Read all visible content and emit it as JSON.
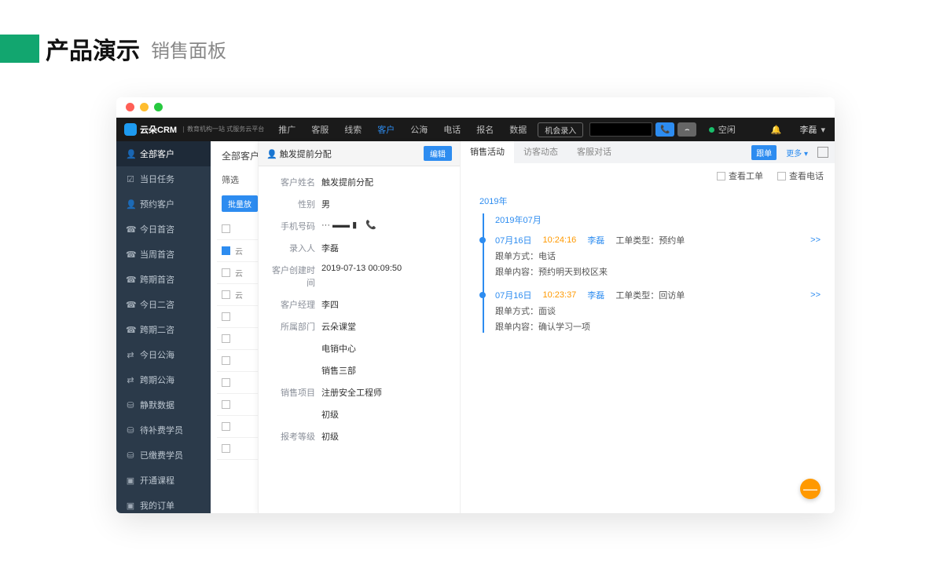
{
  "page": {
    "title_main": "产品演示",
    "title_sub": "销售面板"
  },
  "logo": {
    "brand": "云朵CRM",
    "tagline": "教育机构一站\n式服务云平台"
  },
  "nav": {
    "items": [
      "推广",
      "客服",
      "线索",
      "客户",
      "公海",
      "电话",
      "报名",
      "数据"
    ],
    "active": "客户",
    "opportunity": "机会录入"
  },
  "status": {
    "text": "空闲",
    "user": "李磊",
    "chev": "▾"
  },
  "sidebar": {
    "items": [
      {
        "ico": "👤",
        "label": "全部客户",
        "active": true
      },
      {
        "ico": "☑",
        "label": "当日任务"
      },
      {
        "ico": "👤",
        "label": "预约客户"
      },
      {
        "ico": "☎",
        "label": "今日首咨"
      },
      {
        "ico": "☎",
        "label": "当周首咨"
      },
      {
        "ico": "☎",
        "label": "跨期首咨"
      },
      {
        "ico": "☎",
        "label": "今日二咨"
      },
      {
        "ico": "☎",
        "label": "跨期二咨"
      },
      {
        "ico": "⇄",
        "label": "今日公海"
      },
      {
        "ico": "⇄",
        "label": "跨期公海"
      },
      {
        "ico": "⛁",
        "label": "静默数据"
      },
      {
        "ico": "⛁",
        "label": "待补费学员"
      },
      {
        "ico": "⛁",
        "label": "已缴费学员"
      },
      {
        "ico": "▣",
        "label": "开通课程"
      },
      {
        "ico": "▣",
        "label": "我的订单"
      }
    ]
  },
  "list": {
    "title": "全部客户",
    "filter": "筛选",
    "bulk": "批量放"
  },
  "ghost_rows": [
    {
      "chk": false,
      "txt": ""
    },
    {
      "chk": true,
      "txt": "云"
    },
    {
      "chk": false,
      "txt": "云"
    },
    {
      "chk": false,
      "txt": "云"
    },
    {
      "chk": false,
      "txt": ""
    },
    {
      "chk": false,
      "txt": ""
    },
    {
      "chk": false,
      "txt": ""
    },
    {
      "chk": false,
      "txt": ""
    },
    {
      "chk": false,
      "txt": ""
    },
    {
      "chk": false,
      "txt": ""
    },
    {
      "chk": false,
      "txt": ""
    }
  ],
  "detail": {
    "head_ico": "👤",
    "head_title": "触发提前分配",
    "edit": "编辑",
    "fields": [
      {
        "label": "客户姓名",
        "val": "触发提前分配"
      },
      {
        "label": "性别",
        "val": "男"
      },
      {
        "label": "手机号码",
        "val": "··· ▬▬ ▮",
        "phone": true
      },
      {
        "label": "录入人",
        "val": "李磊"
      },
      {
        "label": "客户创建时间",
        "val": "2019-07-13 00:09:50"
      },
      {
        "label": "客户经理",
        "val": "李四"
      },
      {
        "label": "所属部门",
        "val": "云朵课堂"
      },
      {
        "label": "",
        "val": "电销中心"
      },
      {
        "label": "",
        "val": "销售三部"
      },
      {
        "label": "销售项目",
        "val": "注册安全工程师"
      },
      {
        "label": "",
        "val": "初级"
      },
      {
        "label": "报考等级",
        "val": "初级"
      }
    ]
  },
  "activity": {
    "tabs": [
      "销售活动",
      "访客动态",
      "客服对话"
    ],
    "active": "销售活动",
    "btn_follow": "跟单",
    "btn_more": "更多 ▾",
    "filter_ticket": "查看工单",
    "filter_call": "查看电话",
    "year": "2019年",
    "month": "2019年07月",
    "cards": [
      {
        "date": "07月16日",
        "time": "10:24:16",
        "user": "李磊",
        "type_label": "工单类型：",
        "type": "预约单",
        "more": ">>",
        "lines": [
          {
            "k": "跟单方式：",
            "v": "电话"
          },
          {
            "k": "跟单内容：",
            "v": "预约明天到校区来"
          }
        ]
      },
      {
        "date": "07月16日",
        "time": "10:23:37",
        "user": "李磊",
        "type_label": "工单类型：",
        "type": "回访单",
        "more": ">>",
        "lines": [
          {
            "k": "跟单方式：",
            "v": "面谈"
          },
          {
            "k": "跟单内容：",
            "v": "确认学习一项"
          }
        ]
      }
    ]
  },
  "fab": "—"
}
